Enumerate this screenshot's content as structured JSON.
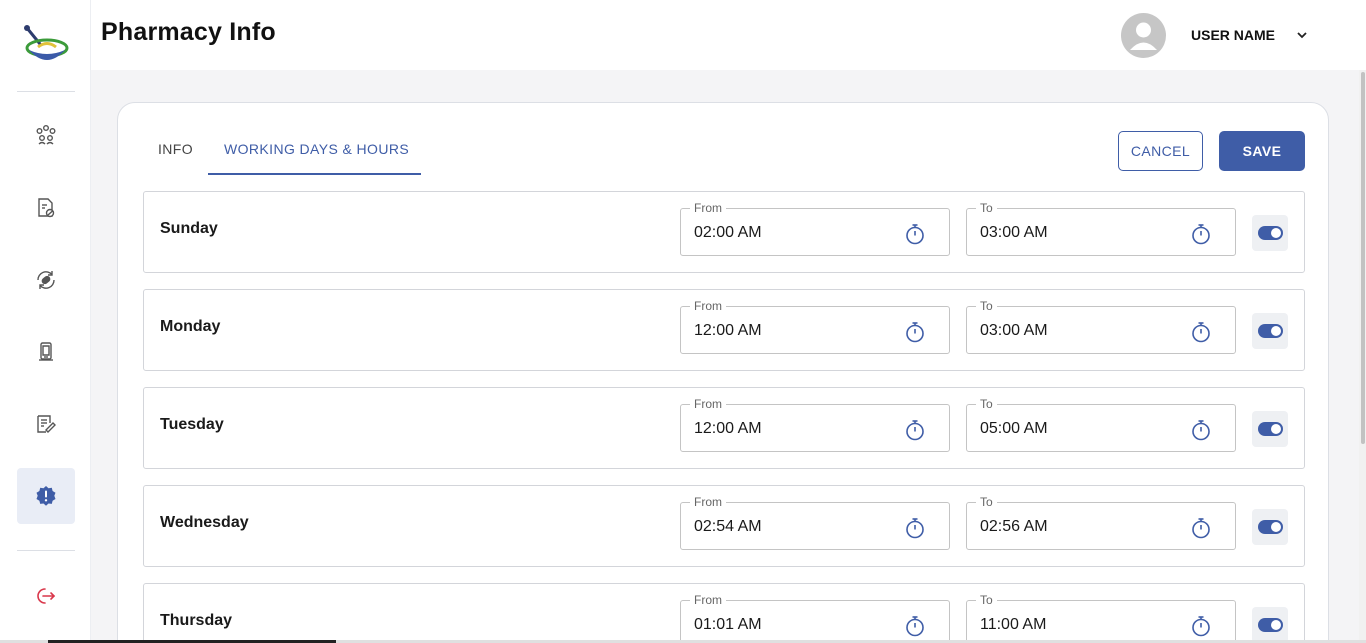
{
  "header": {
    "title": "Pharmacy Info",
    "user_name": "USER NAME"
  },
  "sidebar": {
    "items": [
      {
        "icon": "users-group-icon"
      },
      {
        "icon": "prescription-icon"
      },
      {
        "icon": "pill-refresh-icon"
      },
      {
        "icon": "mobile-device-icon"
      },
      {
        "icon": "edit-note-icon"
      },
      {
        "icon": "pharmacy-info-badge-icon",
        "active": true
      },
      {
        "icon": "logout-icon"
      }
    ]
  },
  "tabs": [
    {
      "label": "INFO"
    },
    {
      "label": "WORKING DAYS & HOURS",
      "active": true
    }
  ],
  "actions": {
    "cancel_label": "CANCEL",
    "save_label": "SAVE"
  },
  "field_labels": {
    "from": "From",
    "to": "To"
  },
  "days": [
    {
      "name": "Sunday",
      "from": "02:00 AM",
      "to": "03:00 AM",
      "enabled": true
    },
    {
      "name": "Monday",
      "from": "12:00 AM",
      "to": "03:00 AM",
      "enabled": true
    },
    {
      "name": "Tuesday",
      "from": "12:00 AM",
      "to": "05:00 AM",
      "enabled": true
    },
    {
      "name": "Wednesday",
      "from": "02:54 AM",
      "to": "02:56 AM",
      "enabled": true
    },
    {
      "name": "Thursday",
      "from": "01:01 AM",
      "to": "11:00 AM",
      "enabled": true
    }
  ],
  "colors": {
    "accent": "#3f5da7",
    "logout": "#d9364a",
    "active_nav_bg": "#e9edf6"
  }
}
